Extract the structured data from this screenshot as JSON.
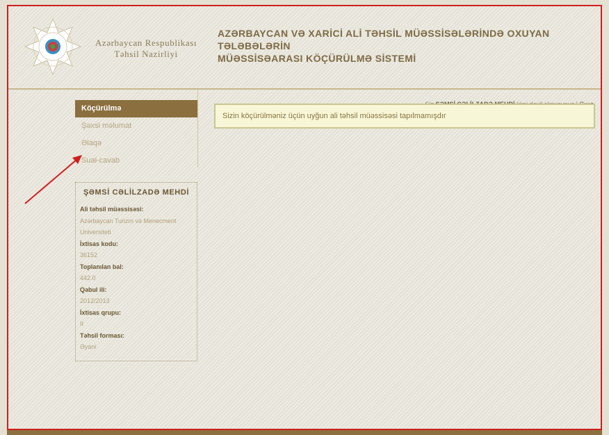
{
  "header": {
    "ministry_line1": "Azərbaycan Respublikası",
    "ministry_line2": "Təhsil Nazirliyi",
    "system_title_line1": "AZƏRBAYCAN VƏ XARİCİ ALİ TƏHSİL MÜƏSSİSƏLƏRİNDƏ OXUYAN TƏLƏBƏLƏRİN",
    "system_title_line2": "MÜƏSSİSƏARASI KÖÇÜRÜLMƏ SİSTEMİ"
  },
  "userline": {
    "prefix": "Siz",
    "user_name": "ŞƏMSİ CƏLİLZADƏ MEHDİ",
    "suffix": "kimi daxil olmusunuz",
    "separator": "|",
    "logout_label": "Çıxış"
  },
  "menu": {
    "items": [
      {
        "label": "Köçürülmə"
      },
      {
        "label": "Şəxsi məlumat"
      },
      {
        "label": "Əlaqə"
      },
      {
        "label": "Sual-cavab"
      }
    ]
  },
  "profile": {
    "name": "ŞƏMSİ CƏLİLZADƏ MEHDİ",
    "institution_label": "Ali təhsil müəssisəsi:",
    "institution_value_line1": "Azərbaycan Turizm və Menecment",
    "institution_value_line2": "Universiteti",
    "specialty_code_label": "İxtisas kodu:",
    "specialty_code_value": "36152",
    "score_label": "Toplanılan bal:",
    "score_value": "442.0",
    "admission_year_label": "Qəbul ili:",
    "admission_year_value": "2012/2013",
    "specialty_group_label": "İxtisas qrupu:",
    "specialty_group_value": "II",
    "education_form_label": "Təhsil forması:",
    "education_form_value": "Əyani"
  },
  "notice": {
    "text": "Sizin köçürülməniz üçün uyğun ali təhsil müəssisəsi tapılmamışdır"
  },
  "colors": {
    "accent": "#8b6f3f",
    "annotation_arrow": "#d01e1e",
    "frame_border": "#d01e1e"
  }
}
